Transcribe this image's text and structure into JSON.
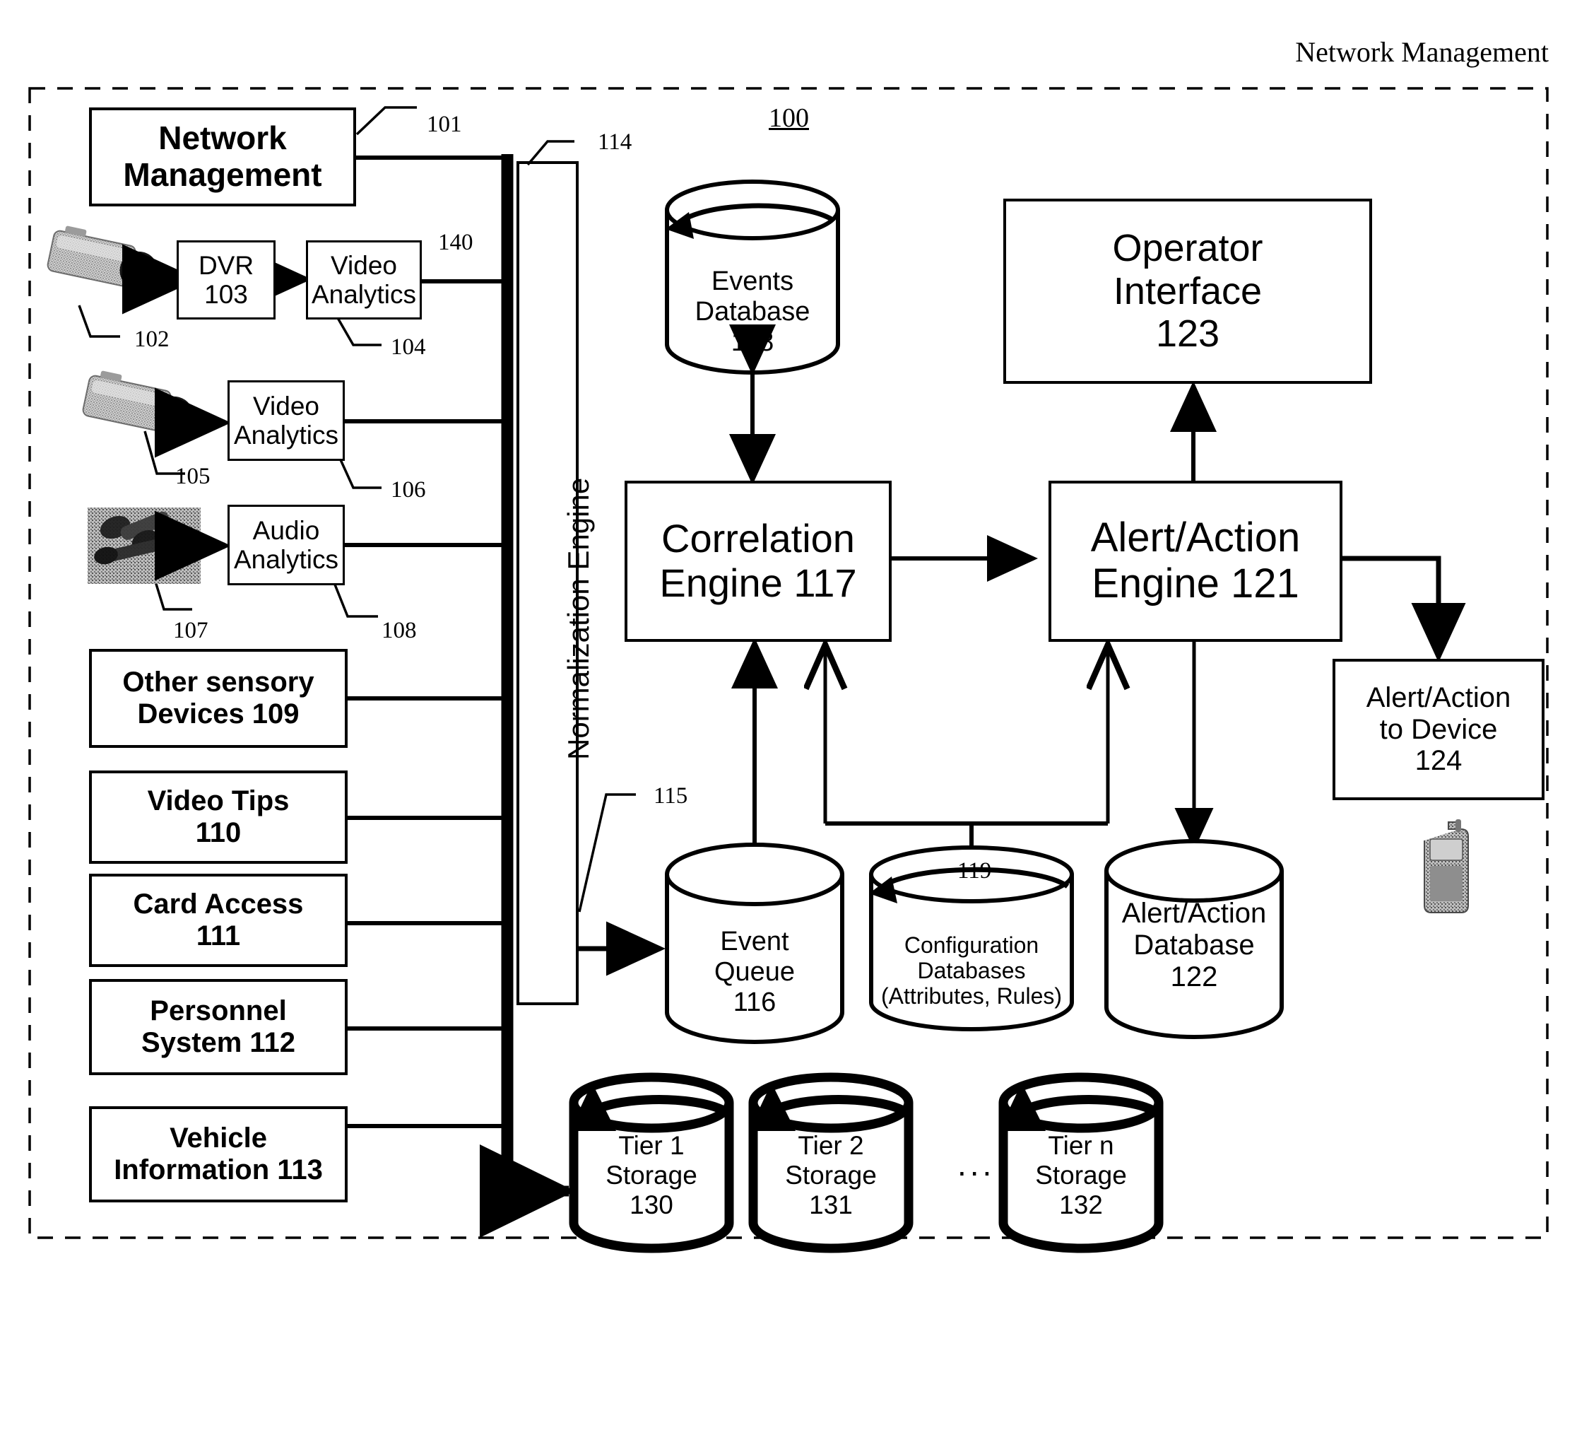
{
  "page": {
    "header_title": "Network Management",
    "figure_number": "100"
  },
  "reference_numbers": {
    "n101": "101",
    "n102": "102",
    "n104": "104",
    "n105": "105",
    "n106": "106",
    "n107": "107",
    "n108": "108",
    "n114": "114",
    "n115": "115",
    "n119": "119",
    "n140": "140"
  },
  "sources": {
    "network_management": "Network Management",
    "dvr": "DVR\n103",
    "video_analytics_1": "Video\nAnalytics",
    "video_analytics_2": "Video\nAnalytics",
    "audio_analytics": "Audio\nAnalytics",
    "other_sensory_devices": "Other sensory\nDevices 109",
    "video_tips": "Video Tips\n110",
    "card_access": "Card Access\n111",
    "personnel_system": "Personnel\nSystem 112",
    "vehicle_information": "Vehicle\nInformation 113"
  },
  "engine_bar": {
    "label": "Normalization Engine"
  },
  "processing": {
    "correlation_engine": "Correlation\nEngine 117",
    "alert_action_engine": "Alert/Action\nEngine 121",
    "operator_interface": "Operator\nInterface\n123",
    "alert_action_to_device": "Alert/Action\nto Device\n124"
  },
  "databases": {
    "events_database": "Events\nDatabase\n118",
    "event_queue": "Event\nQueue\n116",
    "configuration_databases": "Configuration\nDatabases\n(Attributes, Rules)",
    "alert_action_database": "Alert/Action\nDatabase\n122"
  },
  "storage": {
    "tier1": "Tier 1\nStorage\n130",
    "tier2": "Tier 2\nStorage\n131",
    "tiern": "Tier n\nStorage\n132",
    "ellipsis": "..."
  },
  "icons": {
    "camera_1": "camera-icon",
    "camera_2": "camera-icon",
    "microphone": "microphone-icon",
    "mobile_phone": "mobile-phone-icon"
  },
  "colors": {
    "line": "#000000",
    "background": "#ffffff"
  }
}
